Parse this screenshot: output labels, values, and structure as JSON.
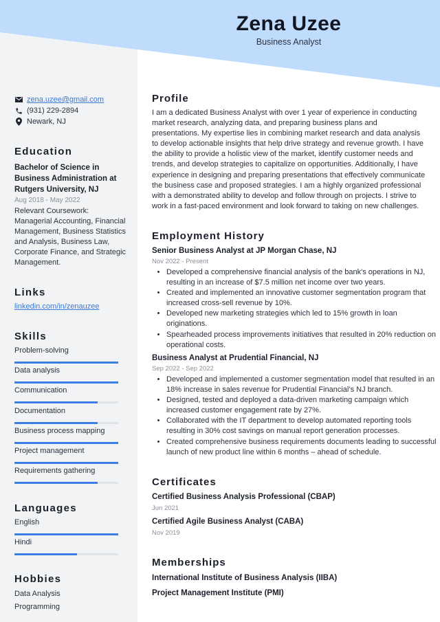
{
  "header": {
    "name": "Zena Uzee",
    "role": "Business Analyst"
  },
  "colors": {
    "header_band": "#bfdcfd",
    "sidebar_bg": "#f2f3f5",
    "accent": "#3a7ee6",
    "link": "#3a78d6"
  },
  "contact": {
    "email": {
      "icon": "envelope-icon",
      "text": "zena.uzee@gmail.com"
    },
    "phone": {
      "icon": "phone-icon",
      "text": "(931) 229-2894"
    },
    "location": {
      "icon": "map-pin-icon",
      "text": "Newark, NJ"
    }
  },
  "education": {
    "title": "Education",
    "degree_lines": [
      "Bachelor of Science in",
      "Business Administration at",
      "Rutgers University, NJ"
    ],
    "dates": "Aug 2018 - May 2022",
    "coursework_lines": [
      "Relevant Coursework:",
      "Managerial Accounting, Financial",
      "Management, Business Statistics",
      "and Analysis, Business Law,",
      "Corporate Finance, and Strategic",
      "Management."
    ]
  },
  "links": {
    "title": "Links",
    "items": [
      {
        "text": "linkedin.com/in/zenauzee"
      }
    ]
  },
  "skills": {
    "title": "Skills",
    "items": [
      {
        "label": "Problem-solving",
        "level_pct": 100
      },
      {
        "label": "Data analysis",
        "level_pct": 100
      },
      {
        "label": "Communication",
        "level_pct": 80
      },
      {
        "label": "Documentation",
        "level_pct": 80
      },
      {
        "label": "Business process mapping",
        "level_pct": 100
      },
      {
        "label": "Project management",
        "level_pct": 100
      },
      {
        "label": "Requirements gathering",
        "level_pct": 80
      }
    ]
  },
  "languages": {
    "title": "Languages",
    "items": [
      {
        "label": "English",
        "level_pct": 100
      },
      {
        "label": "Hindi",
        "level_pct": 60
      }
    ]
  },
  "hobbies": {
    "title": "Hobbies",
    "items": [
      "Data Analysis",
      "Programming"
    ]
  },
  "profile": {
    "title": "Profile",
    "text": "I am a dedicated Business Analyst with over 1 year of experience in conducting market research, analyzing data, and preparing business plans and presentations. My expertise lies in combining market research and data analysis to develop actionable insights that help drive strategy and revenue growth. I have the ability to provide a holistic view of the market, identify customer needs and trends, and develop strategies to capitalize on opportunities. Additionally, I have experience in designing and preparing presentations that effectively communicate the business case and proposed strategies. I am a highly organized professional with a demonstrated ability to develop and follow through on projects. I strive to work in a fast-paced environment and look forward to taking on new challenges."
  },
  "employment": {
    "title": "Employment History",
    "jobs": [
      {
        "title": "Senior Business Analyst at JP Morgan Chase, NJ",
        "dates": "Nov 2022 - Present",
        "bullets": [
          "Developed a comprehensive financial analysis of the bank's operations in NJ, resulting in an increase of $7.5 million net income over two years.",
          "Created and implemented an innovative customer segmentation program that increased cross-sell revenue by 10%.",
          "Developed new marketing strategies which led to 15% growth in loan originations.",
          "Spearheaded process improvements initiatives that resulted in 20% reduction on operational costs."
        ]
      },
      {
        "title": "Business Analyst at Prudential Financial, NJ",
        "dates": "Sep 2022 - Sep 2022",
        "bullets": [
          "Developed and implemented a customer segmentation model that resulted in an 18% increase in sales revenue for Prudential Financial’s NJ branch.",
          "Designed, tested and deployed a data-driven marketing campaign which increased customer engagement rate by 27%.",
          "Collaborated with the IT department to develop automated reporting tools resulting in 30% cost savings on manual report generation processes.",
          "Created comprehensive business requirements documents leading to successful launch of new product line within 6 months – ahead of schedule."
        ]
      }
    ]
  },
  "certificates": {
    "title": "Certificates",
    "items": [
      {
        "name": "Certified Business Analysis Professional (CBAP)",
        "date": "Jun 2021"
      },
      {
        "name": "Certified Agile Business Analyst (CABA)",
        "date": "Nov 2019"
      }
    ]
  },
  "memberships": {
    "title": "Memberships",
    "items": [
      "International Institute of Business Analysis (IIBA)",
      "Project Management Institute (PMI)"
    ]
  }
}
